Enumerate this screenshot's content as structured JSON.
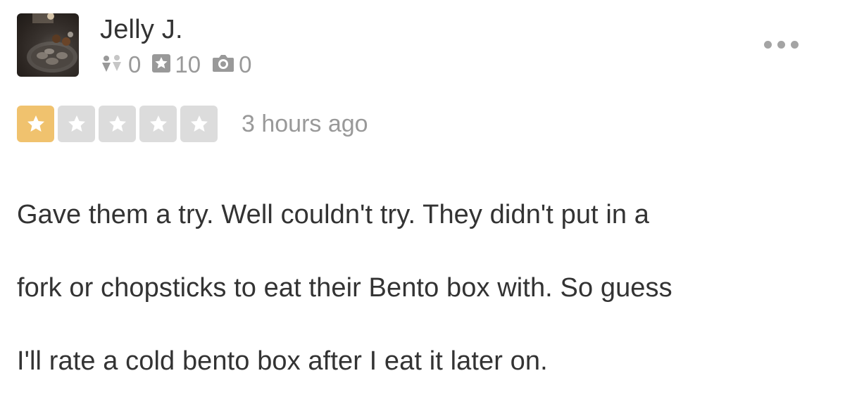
{
  "reviewer": {
    "name": "Jelly J.",
    "avatar_icon": "user-photo-avatar",
    "stats": {
      "friends": "0",
      "friends_icon": "friends-icon",
      "reviews": "10",
      "reviews_icon": "star-review-icon",
      "photos": "0",
      "photos_icon": "camera-icon"
    }
  },
  "menu_icon": "more-options-icon",
  "rating": {
    "value": 1,
    "max": 5,
    "active_color": "#f0c26e",
    "inactive_color": "#dcdcdc"
  },
  "time_ago": "3 hours ago",
  "review_lines": [
    "Gave them a try.  Well couldn't try. They didn't put in a",
    "fork or chopsticks to eat their Bento box with.  So guess",
    "I'll rate a cold bento box after I eat it later on."
  ]
}
